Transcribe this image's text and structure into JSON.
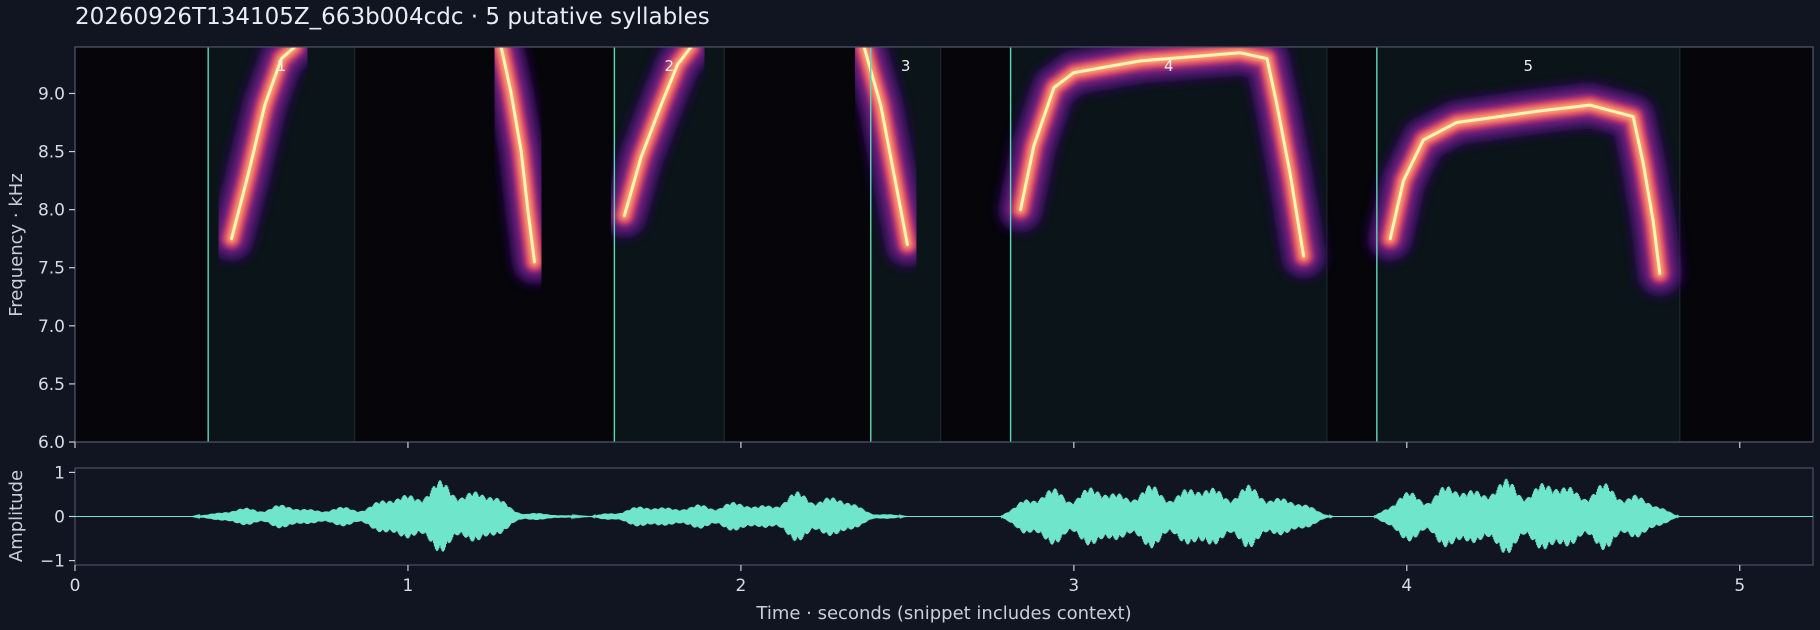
{
  "title": "20260926T134105Z_663b004cdc  ·  5 putative syllables",
  "colors": {
    "background": "#111522",
    "panel": "#05050a",
    "segment_fill": "#0b1418",
    "segment_line": "#5fd6b4",
    "waveform": "#6fe6cc",
    "axis": "#4b5264",
    "magma": [
      "#000004",
      "#3b0f70",
      "#8c2981",
      "#de4968",
      "#fe9f6d",
      "#fcfdbf"
    ]
  },
  "chart_data": [
    {
      "type": "heatmap",
      "name": "spectrogram",
      "ylabel": "Frequency · kHz",
      "xlim": [
        0,
        5.22
      ],
      "ylim": [
        6.0,
        9.4
      ],
      "yticks": [
        6.0,
        6.5,
        7.0,
        7.5,
        8.0,
        8.5,
        9.0
      ],
      "ytick_labels": [
        "6.0",
        "6.5",
        "7.0",
        "7.5",
        "8.0",
        "8.5",
        "9.0"
      ],
      "syllables": [
        {
          "label": "1",
          "start": 0.4,
          "end": 0.84
        },
        {
          "label": "2",
          "start": 1.62,
          "end": 1.95
        },
        {
          "label": "3",
          "start": 2.39,
          "end": 2.6
        },
        {
          "label": "4",
          "start": 2.81,
          "end": 3.76
        },
        {
          "label": "5",
          "start": 3.91,
          "end": 4.82
        }
      ],
      "traces": [
        {
          "points": [
            [
              0.47,
              7.75
            ],
            [
              0.52,
              8.3
            ],
            [
              0.57,
              8.9
            ],
            [
              0.62,
              9.3
            ],
            [
              0.66,
              9.4
            ]
          ]
        },
        {
          "points": [
            [
              1.28,
              9.4
            ],
            [
              1.31,
              9.0
            ],
            [
              1.34,
              8.5
            ],
            [
              1.36,
              8.0
            ],
            [
              1.38,
              7.55
            ]
          ]
        },
        {
          "points": [
            [
              1.65,
              7.95
            ],
            [
              1.7,
              8.45
            ],
            [
              1.76,
              8.9
            ],
            [
              1.81,
              9.25
            ],
            [
              1.85,
              9.4
            ]
          ]
        },
        {
          "points": [
            [
              2.37,
              9.4
            ],
            [
              2.42,
              8.9
            ],
            [
              2.46,
              8.3
            ],
            [
              2.5,
              7.7
            ]
          ]
        },
        {
          "points": [
            [
              2.84,
              8.0
            ],
            [
              2.88,
              8.55
            ],
            [
              2.94,
              9.05
            ],
            [
              3.0,
              9.18
            ],
            [
              3.2,
              9.28
            ],
            [
              3.5,
              9.35
            ],
            [
              3.58,
              9.3
            ],
            [
              3.61,
              8.9
            ],
            [
              3.65,
              8.3
            ],
            [
              3.69,
              7.6
            ]
          ]
        },
        {
          "points": [
            [
              3.95,
              7.75
            ],
            [
              3.99,
              8.25
            ],
            [
              4.05,
              8.6
            ],
            [
              4.15,
              8.75
            ],
            [
              4.4,
              8.85
            ],
            [
              4.55,
              8.9
            ],
            [
              4.68,
              8.8
            ],
            [
              4.71,
              8.4
            ],
            [
              4.74,
              7.9
            ],
            [
              4.76,
              7.45
            ]
          ]
        }
      ]
    },
    {
      "type": "line",
      "name": "waveform",
      "ylabel": "Amplitude",
      "xlabel": "Time · seconds (snippet includes context)",
      "xlim": [
        0,
        5.22
      ],
      "ylim": [
        -1.1,
        1.1
      ],
      "xticks": [
        0,
        1,
        2,
        3,
        4,
        5
      ],
      "xtick_labels": [
        "0",
        "1",
        "2",
        "3",
        "4",
        "5"
      ],
      "yticks": [
        1,
        0,
        -1
      ],
      "ytick_labels": [
        "1",
        "0",
        "−1"
      ],
      "envelope": [
        {
          "x": 0.35,
          "y": 0.0
        },
        {
          "x": 0.45,
          "y": 0.15
        },
        {
          "x": 0.6,
          "y": 0.3
        },
        {
          "x": 0.75,
          "y": 0.2
        },
        {
          "x": 0.85,
          "y": 0.25
        },
        {
          "x": 0.95,
          "y": 0.5
        },
        {
          "x": 1.05,
          "y": 0.8
        },
        {
          "x": 1.15,
          "y": 0.85
        },
        {
          "x": 1.25,
          "y": 0.6
        },
        {
          "x": 1.35,
          "y": 0.1
        },
        {
          "x": 1.55,
          "y": 0.0
        },
        {
          "x": 1.65,
          "y": 0.2
        },
        {
          "x": 1.75,
          "y": 0.3
        },
        {
          "x": 1.85,
          "y": 0.25
        },
        {
          "x": 1.95,
          "y": 0.4
        },
        {
          "x": 2.05,
          "y": 0.3
        },
        {
          "x": 2.2,
          "y": 0.65
        },
        {
          "x": 2.3,
          "y": 0.5
        },
        {
          "x": 2.4,
          "y": 0.1
        },
        {
          "x": 2.5,
          "y": 0.0
        },
        {
          "x": 2.78,
          "y": 0.0
        },
        {
          "x": 2.85,
          "y": 0.55
        },
        {
          "x": 3.0,
          "y": 0.75
        },
        {
          "x": 3.15,
          "y": 0.7
        },
        {
          "x": 3.3,
          "y": 0.75
        },
        {
          "x": 3.45,
          "y": 0.8
        },
        {
          "x": 3.6,
          "y": 0.65
        },
        {
          "x": 3.7,
          "y": 0.3
        },
        {
          "x": 3.78,
          "y": 0.0
        },
        {
          "x": 3.9,
          "y": 0.0
        },
        {
          "x": 3.98,
          "y": 0.55
        },
        {
          "x": 4.1,
          "y": 0.75
        },
        {
          "x": 4.25,
          "y": 0.85
        },
        {
          "x": 4.4,
          "y": 0.9
        },
        {
          "x": 4.55,
          "y": 0.8
        },
        {
          "x": 4.68,
          "y": 0.7
        },
        {
          "x": 4.75,
          "y": 0.3
        },
        {
          "x": 4.82,
          "y": 0.0
        },
        {
          "x": 5.22,
          "y": 0.0
        }
      ]
    }
  ]
}
